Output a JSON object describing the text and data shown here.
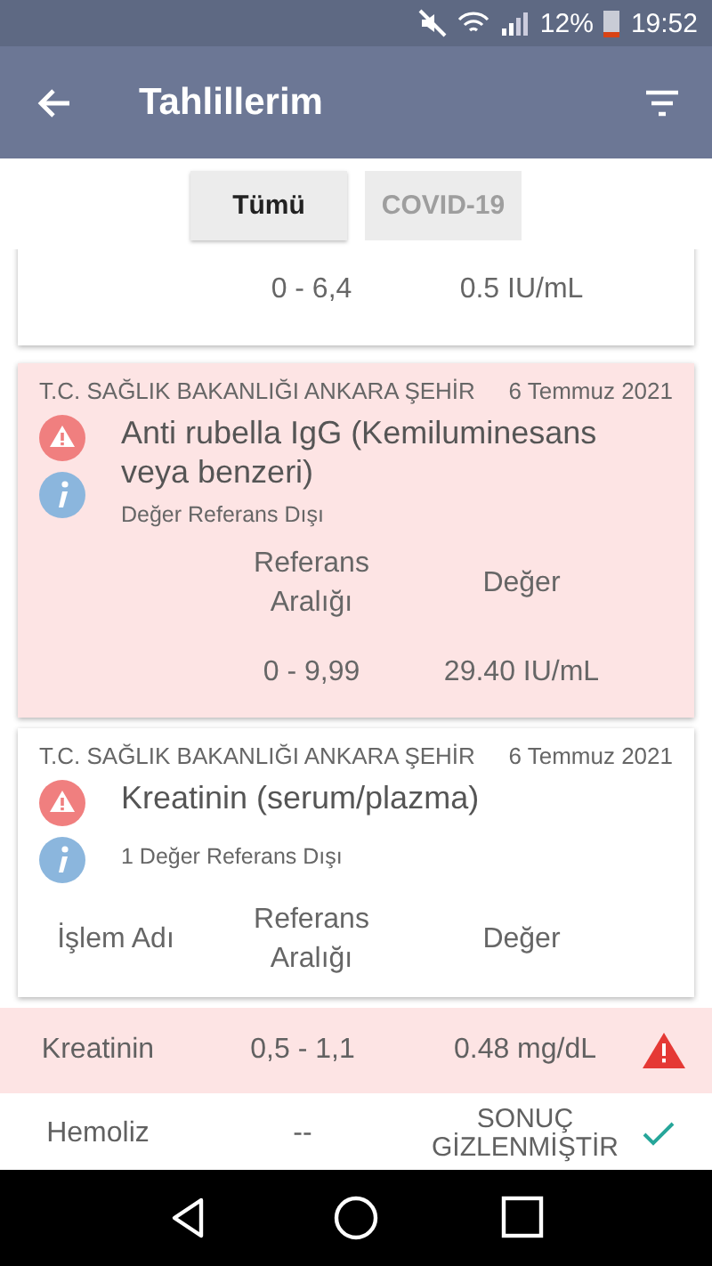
{
  "status_bar": {
    "battery": "12%",
    "time": "19:52"
  },
  "app_bar": {
    "title": "Tahlillerim"
  },
  "filters": [
    {
      "label": "Tümü",
      "selected": true
    },
    {
      "label": "COVID-19",
      "selected": false
    }
  ],
  "results": [
    {
      "kind": "partial",
      "out_of_range": false,
      "reference": "0 - 6,4",
      "value": "0.5 IU/mL"
    },
    {
      "kind": "card",
      "out_of_range": true,
      "hospital": "T.C. SAĞLIK BAKANLIĞI ANKARA ŞEHİR",
      "date": "6 Temmuz 2021",
      "name": "Anti rubella IgG (Kemiluminesans veya benzeri)",
      "note": "Değer Referans Dışı",
      "columns": [
        "",
        "Referans Aralığı",
        "Değer"
      ],
      "rows": [
        {
          "label": "",
          "reference": "0 - 9,99",
          "value": "29.40 IU/mL"
        }
      ]
    },
    {
      "kind": "card",
      "out_of_range": false,
      "hospital": "T.C. SAĞLIK BAKANLIĞI ANKARA ŞEHİR",
      "date": "6 Temmuz 2021",
      "name": "Kreatinin (serum/plazma)",
      "note": "1 Değer Referans Dışı",
      "columns": [
        "İşlem Adı",
        "Referans Aralığı",
        "Değer"
      ]
    },
    {
      "kind": "row",
      "out_of_range": true,
      "label": "Kreatinin",
      "reference": "0,5 - 1,1",
      "value": "0.48 mg/dL"
    },
    {
      "kind": "row",
      "out_of_range": false,
      "label": "Hemoliz",
      "reference": "--",
      "value": "SONUÇ GİZLENMİŞTİR"
    }
  ]
}
